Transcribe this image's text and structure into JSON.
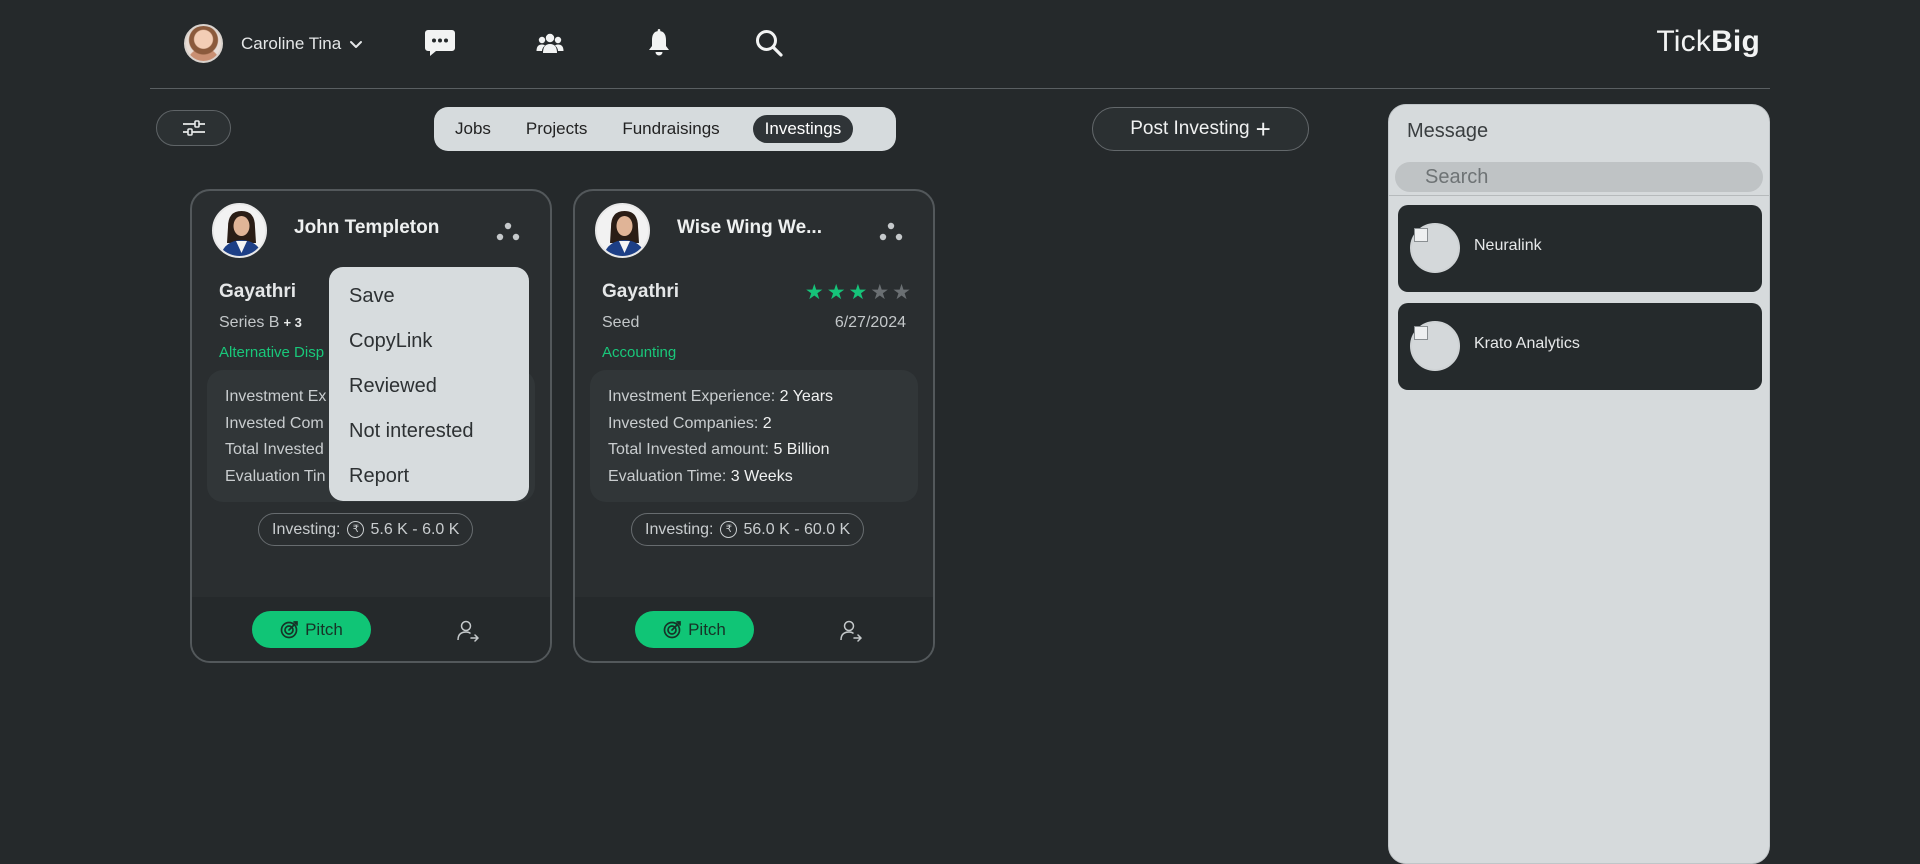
{
  "app": {
    "brand_regular": "Tick",
    "brand_bold": "Big"
  },
  "header": {
    "user_name": "Caroline Tina",
    "icons": [
      "chat-icon",
      "people-icon",
      "bell-icon",
      "search-icon"
    ]
  },
  "tabs": [
    {
      "label": "Jobs",
      "active": false
    },
    {
      "label": "Projects",
      "active": false
    },
    {
      "label": "Fundraisings",
      "active": false
    },
    {
      "label": "Investings",
      "active": true
    }
  ],
  "post_button": {
    "label": "Post Investing",
    "icon": "plus-icon"
  },
  "cards": [
    {
      "name": "John Templeton",
      "subtitle": "Gayathri",
      "stage": "Series B",
      "stage_extra": "+ 3",
      "sector": "Alternative Disp",
      "info": [
        {
          "label": "Investment Ex",
          "value": ""
        },
        {
          "label": "Invested Com",
          "value": ""
        },
        {
          "label": "Total Invested",
          "value": ""
        },
        {
          "label": "Evaluation Tin",
          "value": ""
        }
      ],
      "investing_label": "Investing:",
      "investing_range": "5.6 K - 6.0 K",
      "pitch_label": "Pitch"
    },
    {
      "name": "Wise Wing We...",
      "subtitle": "Gayathri",
      "stage": "Seed",
      "date": "6/27/2024",
      "rating": 3,
      "rating_max": 5,
      "sector": "Accounting",
      "info": [
        {
          "label": "Investment Experience:",
          "value": "2 Years"
        },
        {
          "label": "Invested Companies:",
          "value": "2"
        },
        {
          "label": "Total Invested amount:",
          "value": "5 Billion"
        },
        {
          "label": "Evaluation Time:",
          "value": "3 Weeks"
        }
      ],
      "investing_label": "Investing:",
      "investing_range": "56.0 K - 60.0 K",
      "pitch_label": "Pitch"
    }
  ],
  "context_menu": {
    "items": [
      "Save",
      "CopyLink",
      "Reviewed",
      "Not interested",
      "Report"
    ]
  },
  "messages": {
    "title": "Message",
    "search_placeholder": "Search",
    "conversations": [
      {
        "name": "Neuralink"
      },
      {
        "name": "Krato Analytics"
      }
    ]
  },
  "colors": {
    "background": "#25292b",
    "accent_green": "#10c576",
    "panel": "#d6dadc"
  }
}
